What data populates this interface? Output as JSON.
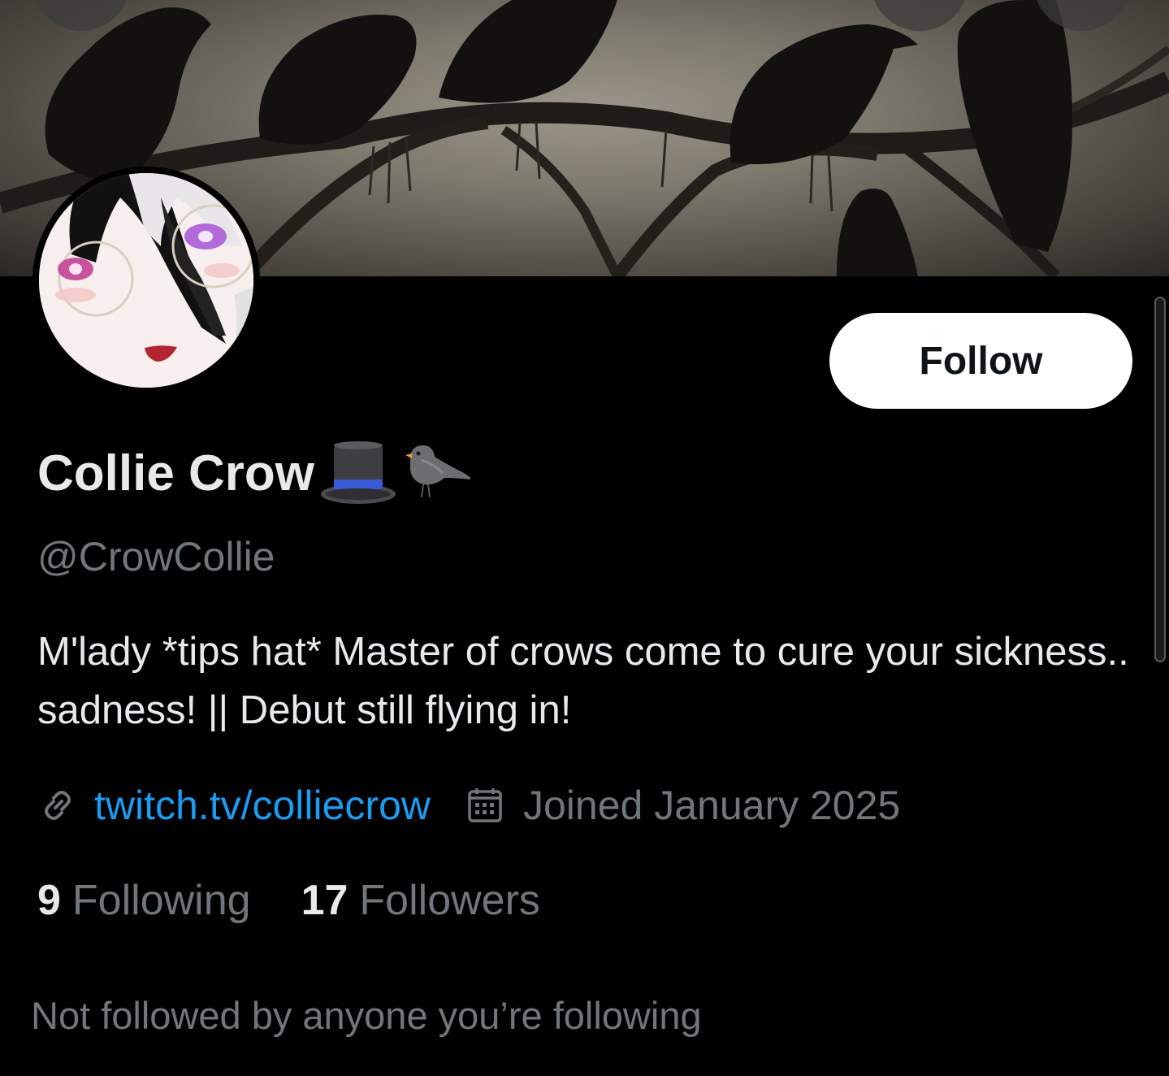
{
  "profile": {
    "display_name": "Collie Crow",
    "name_emojis": [
      "top-hat-emoji",
      "bird-emoji"
    ],
    "handle": "@CrowCollie",
    "bio": "M'lady *tips hat* Master of crows come to cure your sickness.. sadness! || Debut still flying in!",
    "link_text": "twitch.tv/colliecrow",
    "joined_text": "Joined January 2025",
    "following_count": "9",
    "following_label": "Following",
    "followers_count": "17",
    "followers_label": "Followers",
    "mutual_note": "Not followed by anyone you’re following"
  },
  "actions": {
    "follow_label": "Follow"
  },
  "icons": {
    "link": "link-icon",
    "calendar": "calendar-icon"
  },
  "colors": {
    "background": "#000000",
    "primary_text": "#e7e9ea",
    "secondary_text": "#71767b",
    "link": "#1d9bf0",
    "follow_button_bg": "#ffffff",
    "follow_button_text": "#0f1419"
  }
}
